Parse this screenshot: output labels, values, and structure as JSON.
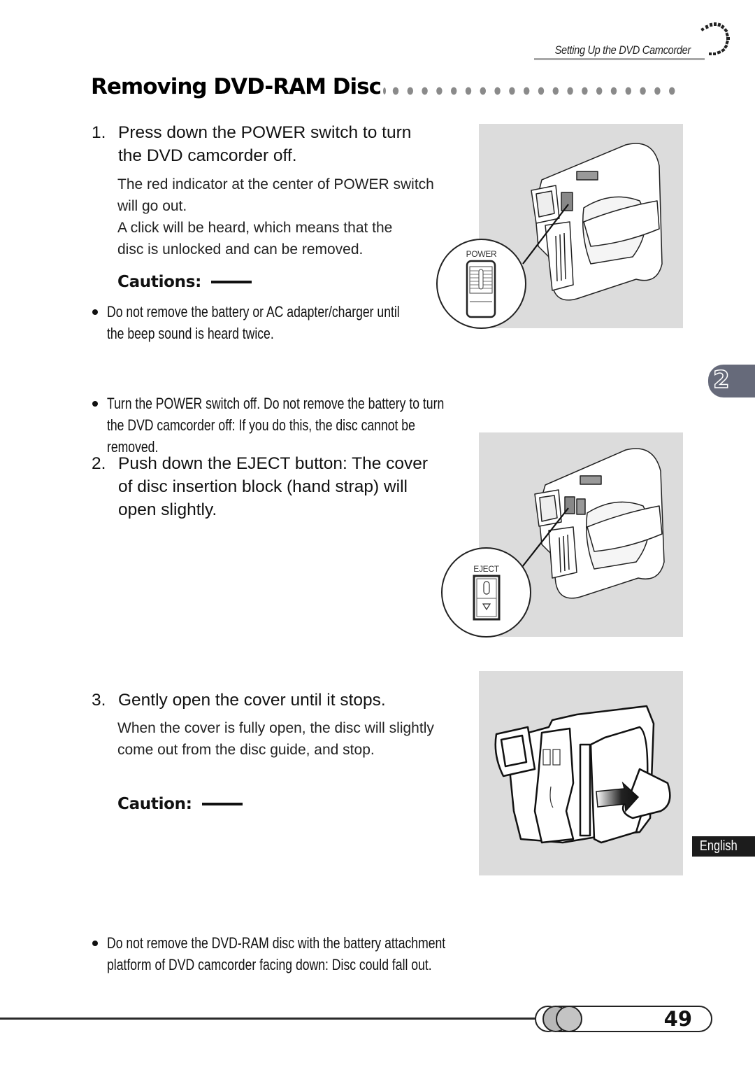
{
  "header": {
    "running_title": "Setting Up the DVD Camcorder"
  },
  "page_title": "Removing DVD-RAM Disc",
  "steps": [
    {
      "number": "1.",
      "lines": [
        "Press down the POWER switch to turn",
        "the DVD camcorder off."
      ],
      "details": [
        "The red indicator at the center of POWER switch",
        "will go out.",
        "A click will be heard, which means that the",
        "disc is unlocked and can be removed."
      ],
      "caution_heading": "Cautions:",
      "cautions": [
        {
          "lines": [
            "Do not remove the battery or AC adapter/charger until",
            "the beep sound is heard twice."
          ]
        },
        {
          "lines": [
            "Turn the POWER switch off. Do not remove the battery to turn",
            "the DVD camcorder off: If you do this, the disc cannot be",
            "removed."
          ]
        }
      ],
      "illustration": {
        "inset_label": "POWER"
      }
    },
    {
      "number": "2.",
      "lines": [
        "Push down the EJECT button: The cover",
        "of disc insertion block (hand strap) will",
        "open slightly."
      ],
      "illustration": {
        "inset_label": "EJECT"
      }
    },
    {
      "number": "3.",
      "lines": [
        "Gently open the cover until it stops."
      ],
      "details": [
        "When the cover is fully open, the disc will slightly",
        "come out from the disc guide, and stop."
      ],
      "caution_heading": "Caution:",
      "cautions": [
        {
          "lines": [
            "Do not remove the DVD-RAM disc with the battery attachment",
            "platform of DVD camcorder facing down: Disc could fall out."
          ]
        }
      ]
    }
  ],
  "chapter_tab": {
    "number": "2",
    "color": "#666a7a"
  },
  "language_tab": "English",
  "footer": {
    "page_number": "49"
  },
  "colors": {
    "illustration_bg": "#dcdcdc",
    "title_dots": "#8a8a8a"
  }
}
